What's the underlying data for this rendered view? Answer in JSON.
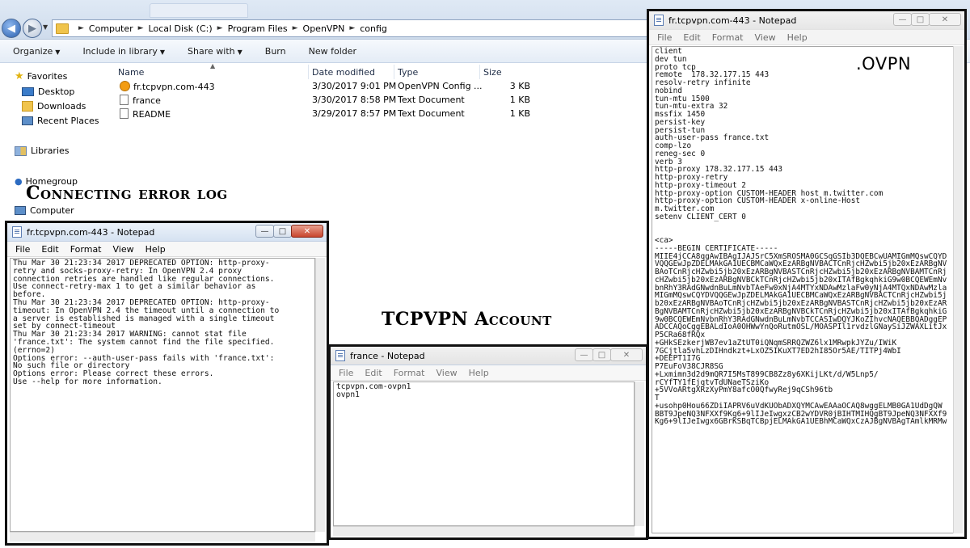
{
  "explorer": {
    "breadcrumbs": [
      "Computer",
      "Local Disk (C:)",
      "Program Files",
      "OpenVPN",
      "config"
    ],
    "toolbar": [
      "Organize",
      "Include in library",
      "Share with",
      "Burn",
      "New folder"
    ],
    "nav": {
      "favorites": "Favorites",
      "desktop": "Desktop",
      "downloads": "Downloads",
      "recent": "Recent Places",
      "libraries": "Libraries",
      "homegroup": "Homegroup",
      "computer": "Computer"
    },
    "columns": [
      "Name",
      "Date modified",
      "Type",
      "Size"
    ],
    "files": [
      {
        "name": "fr.tcpvpn.com-443",
        "date": "3/30/2017 9:01 PM",
        "type": "OpenVPN Config ...",
        "size": "3 KB",
        "icon": "openvpn-config-icon"
      },
      {
        "name": "france",
        "date": "3/30/2017 8:58 PM",
        "type": "Text Document",
        "size": "1 KB",
        "icon": "text-document-icon"
      },
      {
        "name": "README",
        "date": "3/29/2017 8:57 PM",
        "type": "Text Document",
        "size": "1 KB",
        "icon": "text-document-icon"
      }
    ]
  },
  "labels": {
    "error_log": "Connecting error log",
    "account": "TCPVPN Account",
    "ovpn": ".OVPN"
  },
  "notepad_error": {
    "title": "fr.tcpvpn.com-443 - Notepad",
    "menu": [
      "File",
      "Edit",
      "Format",
      "View",
      "Help"
    ],
    "text": "Thu Mar 30 21:23:34 2017 DEPRECATED OPTION: http-proxy-\nretry and socks-proxy-retry: In OpenVPN 2.4 proxy\nconnection retries are handled like regular connections.\nUse connect-retry-max 1 to get a similar behavior as\nbefore.\nThu Mar 30 21:23:34 2017 DEPRECATED OPTION: http-proxy-\ntimeout: In OpenVPN 2.4 the timeout until a connection to\na server is established is managed with a single timeout\nset by connect-timeout\nThu Mar 30 21:23:34 2017 WARNING: cannot stat file\n'france.txt': The system cannot find the file specified.\n(errno=2)\nOptions error: --auth-user-pass fails with 'france.txt':\nNo such file or directory\nOptions error: Please correct these errors.\nUse --help for more information."
  },
  "notepad_account": {
    "title": "france - Notepad",
    "menu": [
      "File",
      "Edit",
      "Format",
      "View",
      "Help"
    ],
    "text": "tcpvpn.com-ovpn1\novpn1"
  },
  "notepad_ovpn": {
    "title": "fr.tcpvpn.com-443 - Notepad",
    "menu": [
      "File",
      "Edit",
      "Format",
      "View",
      "Help"
    ],
    "text": "client\ndev tun\nproto tcp\nremote  178.32.177.15 443\nresolv-retry infinite\nnobind\ntun-mtu 1500\ntun-mtu-extra 32\nmssfix 1450\npersist-key\npersist-tun\nauth-user-pass france.txt\ncomp-lzo\nreneg-sec 0\nverb 3\nhttp-proxy 178.32.177.15 443\nhttp-proxy-retry\nhttp-proxy-timeout 2\nhttp-proxy-option CUSTOM-HEADER host m.twitter.com\nhttp-proxy-option CUSTOM-HEADER x-online-Host\nm.twitter.com\nsetenv CLIENT_CERT 0\n\n\n<ca>\n-----BEGIN CERTIFICATE-----\nMIIE4jCCA8qgAwIBAgIJAJSrC5XmSROSMA0GCSqGSIb3DQEBCwUAMIGmMQswCQYD\nVQQGEwJpZDELMAkGA1UECBMCaWQxEzARBgNVBACTCnRjcHZwbi5jb20xEzARBgNV\nBAoTCnRjcHZwbi5jb20xEzARBgNVBASTCnRjcHZwbi5jb20xEzARBgNVBAMTCnRj\ncHZwbi5jb20xEzARBgNVBCkTCnRjcHZwbi5jb20xITAfBgkqhkiG9w0BCQEWEmNv\nbnRhY3RAdGNwdnBuLmNvbTAeFw0xNjA4MTYxNDAwMzlaFw0yNjA4MTQxNDAwMzla\nMIGmMQswCQYDVQQGEwJpZDELMAkGA1UECBMCaWQxEzARBgNVBACTCnRjcHZwbi5j\nb20xEzARBgNVBAoTCnRjcHZwbi5jb20xEzARBgNVBASTCnRjcHZwbi5jb20xEzAR\nBgNVBAMTCnRjcHZwbi5jb20xEzARBgNVBCkTCnRjcHZwbi5jb20xITAfBgkqhkiG\n9w0BCQEWEmNvbnRhY3RAdGNwdnBuLmNvbTCCASIwDQYJKoZIhvcNAQEBBQADggEP\nADCCAQoCggEBALdIoA0OHWwYnQoRutmOSL/MOASPIl1rvdzlGNaySiJZWAXLitJx\nP5CRa68fRQx\n+GHkSEzkerjWB7ev1aZtUT0iQNqmSRRQZWZ6lx1MRwpkJYZu/IWiK\n7GCjtla5vhLzDIHndkzt+LxOZ5IKuXT7ED2hI85Or5AE/TITPj4WbI\n+DEEPT1I7G\nP7EuFoV38CJR8SG\n+Lxmimn3d2d9mQR7I5MsT899CB8Zz8y6XKijLKt/d/W5Lnp5/\nrCYfTY1fEjqtvTdUNaeTSziKo\n+5VVoARtgXRzXyPmY8afcO0QfwyRej9qCSh96tb\nT\n+usohp0Hou66ZDiIAPRV6uVdKUObADXQYMCAwEAAaOCAQ8wggELMB0GA1UdDgQW\nBBT9JpeNQ3NFXXf9Kg6+9lIJeIwgxzCB2wYDVR0jBIHTMIHQgBT9JpeNQ3NFXXf9\nKg6+9lIJeIwgx6GBrKSBqTCBpjELMAkGA1UEBhMCaWQxCzAJBgNVBAgTAmlkMRMw"
  }
}
